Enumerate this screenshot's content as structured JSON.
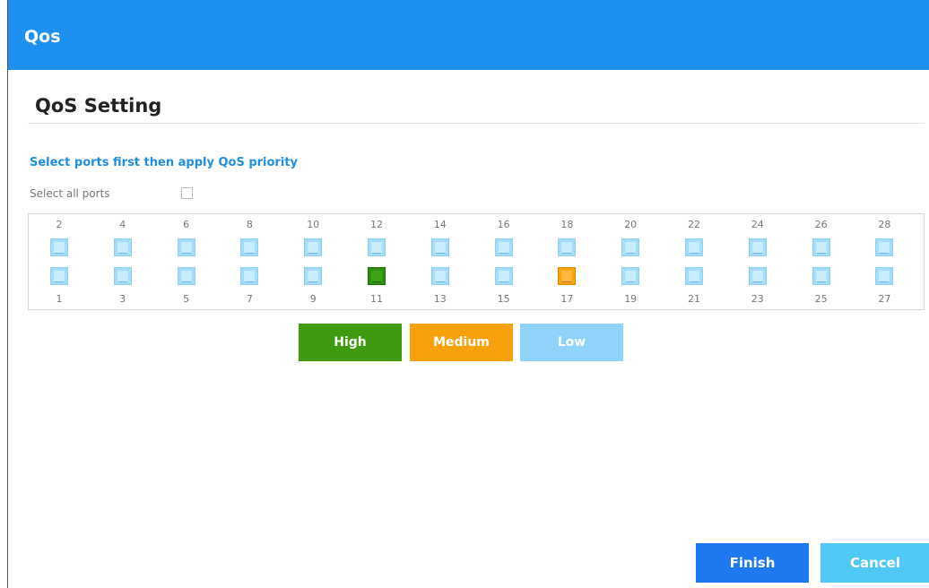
{
  "window": {
    "title": "Qos"
  },
  "section": {
    "title": "QoS Setting"
  },
  "hint": "Select ports first then apply QoS priority",
  "select_all": {
    "label": "Select all ports",
    "checked": false
  },
  "ports": {
    "top": [
      {
        "num": "2",
        "priority": "none"
      },
      {
        "num": "4",
        "priority": "none"
      },
      {
        "num": "6",
        "priority": "none"
      },
      {
        "num": "8",
        "priority": "none"
      },
      {
        "num": "10",
        "priority": "none"
      },
      {
        "num": "12",
        "priority": "none"
      },
      {
        "num": "14",
        "priority": "none"
      },
      {
        "num": "16",
        "priority": "none"
      },
      {
        "num": "18",
        "priority": "none"
      },
      {
        "num": "20",
        "priority": "none"
      },
      {
        "num": "22",
        "priority": "none"
      },
      {
        "num": "24",
        "priority": "none"
      },
      {
        "num": "26",
        "priority": "none"
      },
      {
        "num": "28",
        "priority": "none"
      }
    ],
    "bottom": [
      {
        "num": "1",
        "priority": "none"
      },
      {
        "num": "3",
        "priority": "none"
      },
      {
        "num": "5",
        "priority": "none"
      },
      {
        "num": "7",
        "priority": "none"
      },
      {
        "num": "9",
        "priority": "none"
      },
      {
        "num": "11",
        "priority": "high"
      },
      {
        "num": "13",
        "priority": "none"
      },
      {
        "num": "15",
        "priority": "none"
      },
      {
        "num": "17",
        "priority": "medium"
      },
      {
        "num": "19",
        "priority": "none"
      },
      {
        "num": "21",
        "priority": "none"
      },
      {
        "num": "23",
        "priority": "none"
      },
      {
        "num": "25",
        "priority": "none"
      },
      {
        "num": "27",
        "priority": "none"
      }
    ]
  },
  "priority_buttons": {
    "high": "High",
    "medium": "Medium",
    "low": "Low"
  },
  "actions": {
    "finish": "Finish",
    "cancel": "Cancel"
  },
  "colors": {
    "header": "#1e90f0",
    "high": "#3f9a10",
    "medium": "#f7a10c",
    "low": "#8fd3fa",
    "finish": "#1e78f0",
    "cancel": "#50c8f5",
    "port_idle": "#a6dcf7"
  }
}
